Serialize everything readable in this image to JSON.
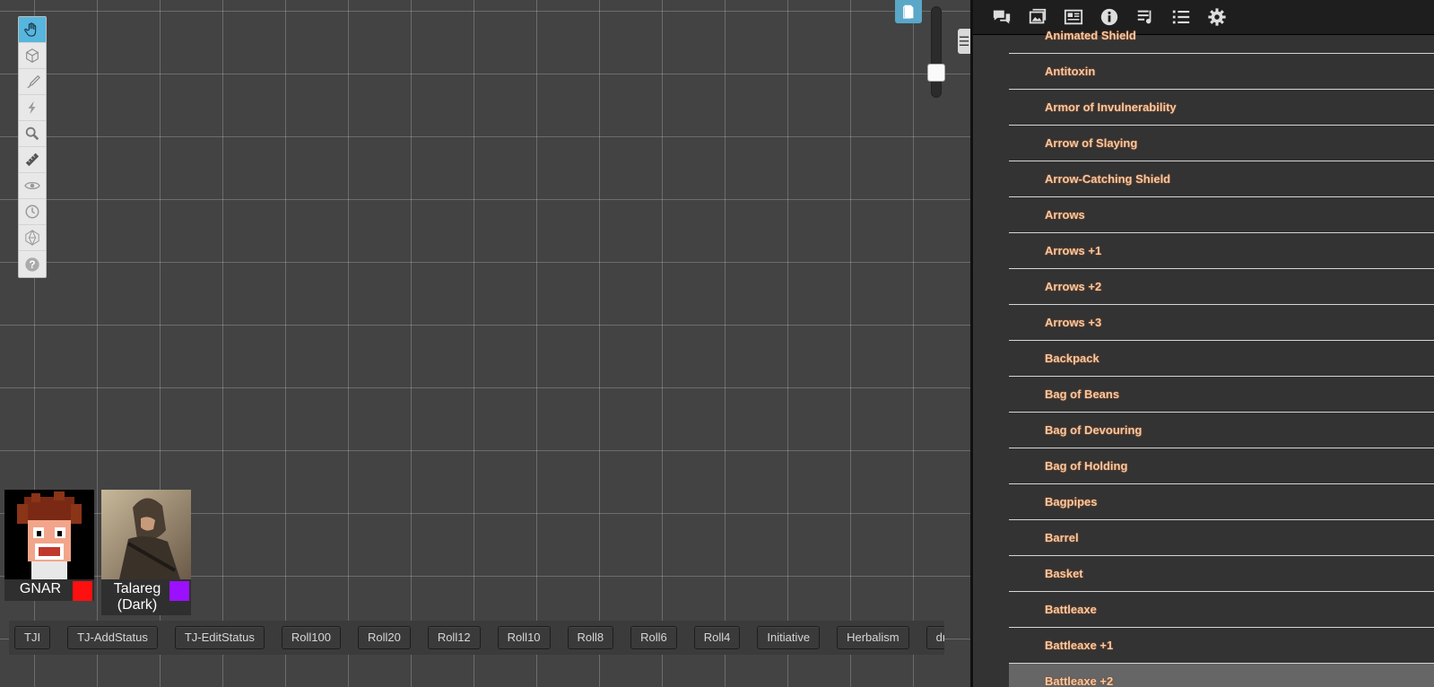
{
  "toolbar": {
    "tools": [
      "pan-hand-icon",
      "layers-cube-icon",
      "draw-brush-icon",
      "fx-lightning-icon",
      "zoom-magnifier-icon",
      "measure-ruler-icon",
      "fog-eye-icon",
      "turn-clock-icon",
      "dice-icon",
      "help-icon"
    ],
    "active": "pan-hand-icon"
  },
  "tokens": [
    {
      "name": "GNAR",
      "color": "#ff1010"
    },
    {
      "name": "Talareg (Dark)",
      "color": "#9b10ff"
    }
  ],
  "macros": [
    "TJI",
    "TJ-AddStatus",
    "TJ-EditStatus",
    "Roll100",
    "Roll20",
    "Roll12",
    "Roll10",
    "Roll8",
    "Roll6",
    "Roll4",
    "Initiative",
    "Herbalism",
    "dr"
  ],
  "sidebar": {
    "tabs": [
      "chat-icon",
      "art-library-icon",
      "journal-icon",
      "compendium-info-icon",
      "jukebox-icon",
      "collections-list-icon",
      "settings-gear-icon"
    ],
    "items": [
      "Animated Shield",
      "Antitoxin",
      "Armor of Invulnerability",
      "Arrow of Slaying",
      "Arrow-Catching Shield",
      "Arrows",
      "Arrows +1",
      "Arrows +2",
      "Arrows +3",
      "Backpack",
      "Bag of Beans",
      "Bag of Devouring",
      "Bag of Holding",
      "Bagpipes",
      "Barrel",
      "Basket",
      "Battleaxe",
      "Battleaxe +1",
      "Battleaxe +2"
    ],
    "selected": "Battleaxe +2"
  },
  "colors": {
    "accent": "#57b6dd",
    "item_text": "#f3c9a3"
  }
}
